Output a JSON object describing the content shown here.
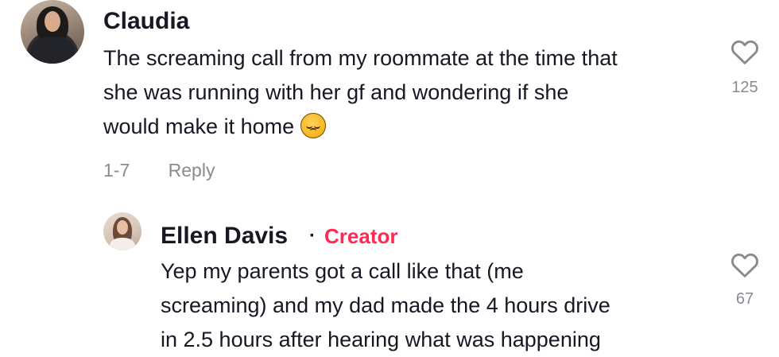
{
  "comments": [
    {
      "username": "Claudia",
      "text_lines": [
        "The screaming call from my roommate at the time that",
        "she was running with her gf and wondering if she",
        "would make it home"
      ],
      "emoji": "pensive-face-emoji",
      "date": "1-7",
      "reply_label": "Reply",
      "likes": "125"
    }
  ],
  "replies": [
    {
      "username": "Ellen Davis",
      "separator": "·",
      "badge": "Creator",
      "text_lines": [
        "Yep my parents got a call like that (me",
        "screaming) and my dad made the 4 hours drive",
        "in 2.5 hours after hearing what was happening"
      ],
      "likes": "67"
    }
  ],
  "colors": {
    "creator_badge": "#fe2c55",
    "muted_text": "#8a8b91",
    "primary_text": "#161823"
  },
  "icons": {
    "like": "heart-outline-icon"
  }
}
